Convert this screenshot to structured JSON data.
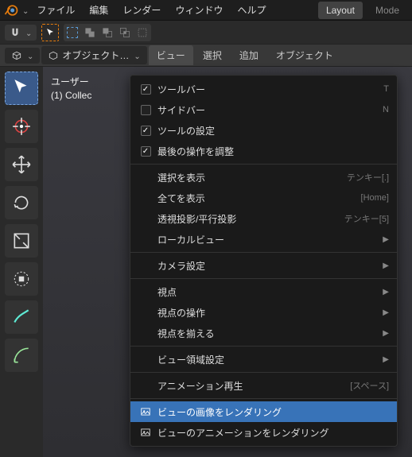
{
  "topbar": {
    "menus": [
      "ファイル",
      "編集",
      "レンダー",
      "ウィンドウ",
      "ヘルプ"
    ],
    "tabs": [
      "Layout",
      "Mode"
    ]
  },
  "header3": {
    "mode_label": "オブジェクト…",
    "tabs": [
      "ビュー",
      "選択",
      "追加",
      "オブジェクト"
    ],
    "active_tab": "ビュー"
  },
  "viewport": {
    "line1": "ユーザー",
    "line2": "(1) Collec"
  },
  "dropdown": {
    "items": [
      {
        "type": "check",
        "checked": true,
        "label": "ツールバー",
        "hint": "T"
      },
      {
        "type": "check",
        "checked": false,
        "label": "サイドバー",
        "hint": "N"
      },
      {
        "type": "check",
        "checked": true,
        "label": "ツールの設定",
        "hint": ""
      },
      {
        "type": "check",
        "checked": true,
        "label": "最後の操作を調整",
        "hint": ""
      },
      {
        "type": "sep"
      },
      {
        "type": "item",
        "label": "選択を表示",
        "hint": "テンキー[.]"
      },
      {
        "type": "item",
        "label": "全てを表示",
        "hint": "[Home]"
      },
      {
        "type": "item",
        "label": "透視投影/平行投影",
        "hint": "テンキー[5]"
      },
      {
        "type": "submenu",
        "label": "ローカルビュー"
      },
      {
        "type": "sep"
      },
      {
        "type": "submenu",
        "label": "カメラ設定"
      },
      {
        "type": "sep"
      },
      {
        "type": "submenu",
        "label": "視点"
      },
      {
        "type": "submenu",
        "label": "視点の操作"
      },
      {
        "type": "submenu",
        "label": "視点を揃える"
      },
      {
        "type": "sep"
      },
      {
        "type": "submenu",
        "label": "ビュー領域設定"
      },
      {
        "type": "sep"
      },
      {
        "type": "item",
        "label": "アニメーション再生",
        "hint": "[スペース]"
      },
      {
        "type": "sep"
      },
      {
        "type": "icon-item",
        "label": "ビューの画像をレンダリング",
        "highlight": true
      },
      {
        "type": "icon-item",
        "label": "ビューのアニメーションをレンダリング"
      }
    ]
  }
}
